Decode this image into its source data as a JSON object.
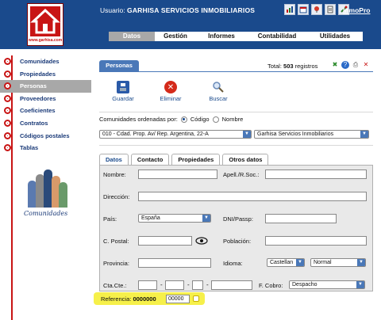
{
  "header": {
    "logo_url_text": "www.garhisa.com",
    "user_label": "Usuario:",
    "user_name": "GARHISA SERVICIOS INMOBILIARIOS",
    "brand_link": "InmoPro",
    "icons": [
      "chart-icon",
      "calendar-icon",
      "pin-icon",
      "document-icon",
      "tools-icon"
    ]
  },
  "topnav": {
    "items": [
      "Datos",
      "Gestión",
      "Informes",
      "Contabilidad",
      "Utilidades"
    ],
    "active": "Datos"
  },
  "sidebar": {
    "items": [
      "Comunidades",
      "Propiedades",
      "Personas",
      "Proveedores",
      "Coeficientes",
      "Contratos",
      "Códigos postales",
      "Tablas"
    ],
    "active": "Personas",
    "caption": "Comunidades"
  },
  "main": {
    "tab": "Personas",
    "total_label": "Total:",
    "total_count": "503",
    "total_suffix": "registros",
    "actions": [
      "Guardar",
      "Eliminar",
      "Buscar"
    ],
    "comm_label": "Comunidades ordenadas por:",
    "radio_codigo": "Código",
    "radio_nombre": "Nombre",
    "select_comunidad": "010 - Cdad. Prop. Av/ Rep. Argentina, 22-A",
    "select_empresa": "Garhisa Servicios Inmobiliarios",
    "subtabs": [
      "Datos",
      "Contacto",
      "Propiedades",
      "Otros datos"
    ]
  },
  "form": {
    "nombre": "Nombre:",
    "apellidos": "Apell./R.Soc.:",
    "direccion": "Dirección:",
    "pais": "País:",
    "pais_value": "España",
    "dni": "DNI/Passp:",
    "cpostal": "C. Postal:",
    "poblacion": "Población:",
    "provincia": "Provincia:",
    "idioma": "Idioma:",
    "idioma_value": "Castellan",
    "nivel_value": "Normal",
    "ctacte": "Cta.Cte.:",
    "fcobro": "F. Cobro:",
    "fcobro_value": "Despacho"
  },
  "referencia": {
    "label": "Referencia:",
    "code": "0000000",
    "suffix": "00000"
  },
  "colors": {
    "header_bg": "#1a4a8c",
    "accent_red": "#c81414",
    "highlight": "#f6f04a"
  }
}
